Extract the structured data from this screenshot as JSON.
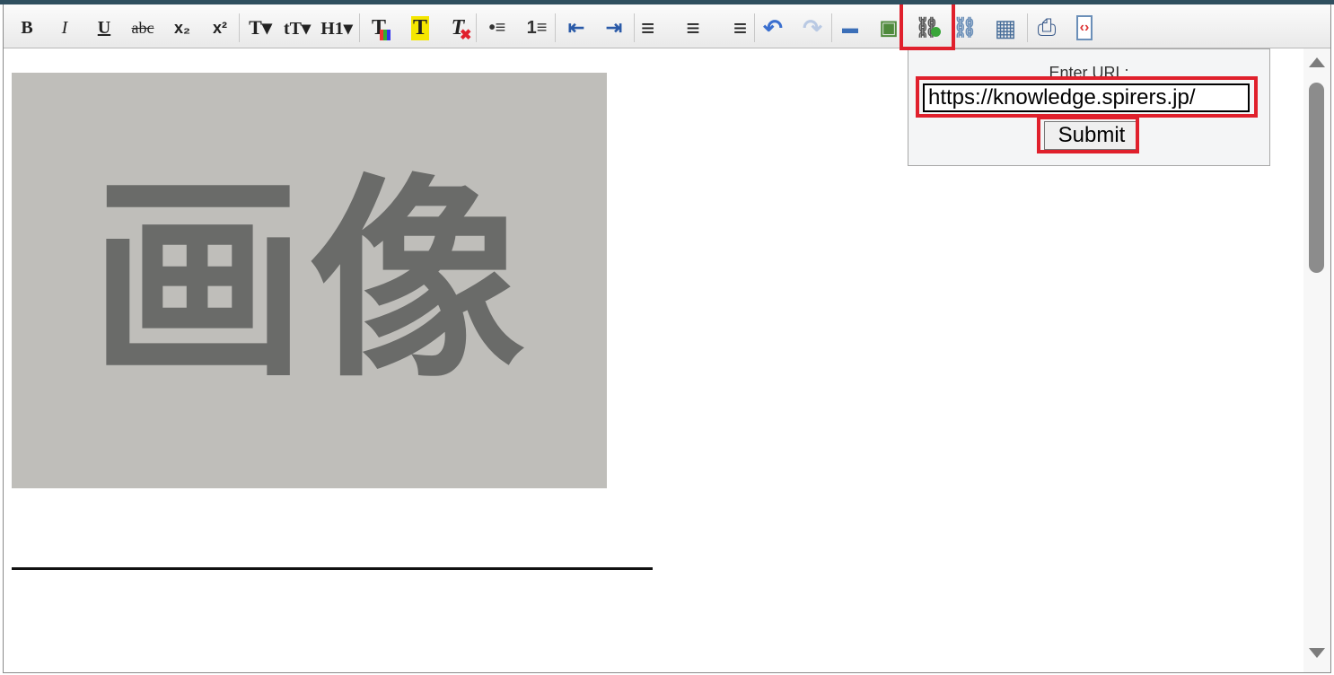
{
  "toolbar": {
    "buttons": [
      {
        "name": "bold-button",
        "glyph": "B"
      },
      {
        "name": "italic-button",
        "glyph": "I"
      },
      {
        "name": "underline-button",
        "glyph": "U"
      },
      {
        "name": "strikethrough-button",
        "glyph": "abc"
      },
      {
        "name": "subscript-button",
        "glyph": "x₂"
      },
      {
        "name": "superscript-button",
        "glyph": "x²"
      },
      {
        "name": "font-family-button",
        "glyph": "T▾"
      },
      {
        "name": "font-size-button",
        "glyph": "tT▾"
      },
      {
        "name": "heading-button",
        "glyph": "H1▾"
      },
      {
        "name": "text-color-button",
        "glyph": "T"
      },
      {
        "name": "highlight-color-button",
        "glyph": "T"
      },
      {
        "name": "clear-format-button",
        "glyph": "T"
      },
      {
        "name": "bulleted-list-button",
        "glyph": "•≡"
      },
      {
        "name": "numbered-list-button",
        "glyph": "1≡"
      },
      {
        "name": "outdent-button",
        "glyph": "⇤"
      },
      {
        "name": "indent-button",
        "glyph": "⇥"
      },
      {
        "name": "align-left-button",
        "glyph": "≡"
      },
      {
        "name": "align-center-button",
        "glyph": "≡"
      },
      {
        "name": "align-right-button",
        "glyph": "≡"
      },
      {
        "name": "undo-button",
        "glyph": "↶"
      },
      {
        "name": "redo-button",
        "glyph": "↷"
      },
      {
        "name": "horizontal-rule-button",
        "glyph": "▬"
      },
      {
        "name": "insert-image-button",
        "glyph": "▣"
      },
      {
        "name": "insert-link-button",
        "glyph": "⛓"
      },
      {
        "name": "remove-link-button",
        "glyph": "⛓"
      },
      {
        "name": "insert-table-button",
        "glyph": "▦"
      },
      {
        "name": "print-button",
        "glyph": "⎙"
      },
      {
        "name": "view-source-button",
        "glyph": "‹›"
      }
    ]
  },
  "content": {
    "image_text": "画像"
  },
  "link_popup": {
    "label": "Enter URL:",
    "url_value": "https://knowledge.spirers.jp/",
    "submit_label": "Submit"
  },
  "colors": {
    "highlight": "#e0202c",
    "toolbar_top_border": "#2f4f5f"
  }
}
